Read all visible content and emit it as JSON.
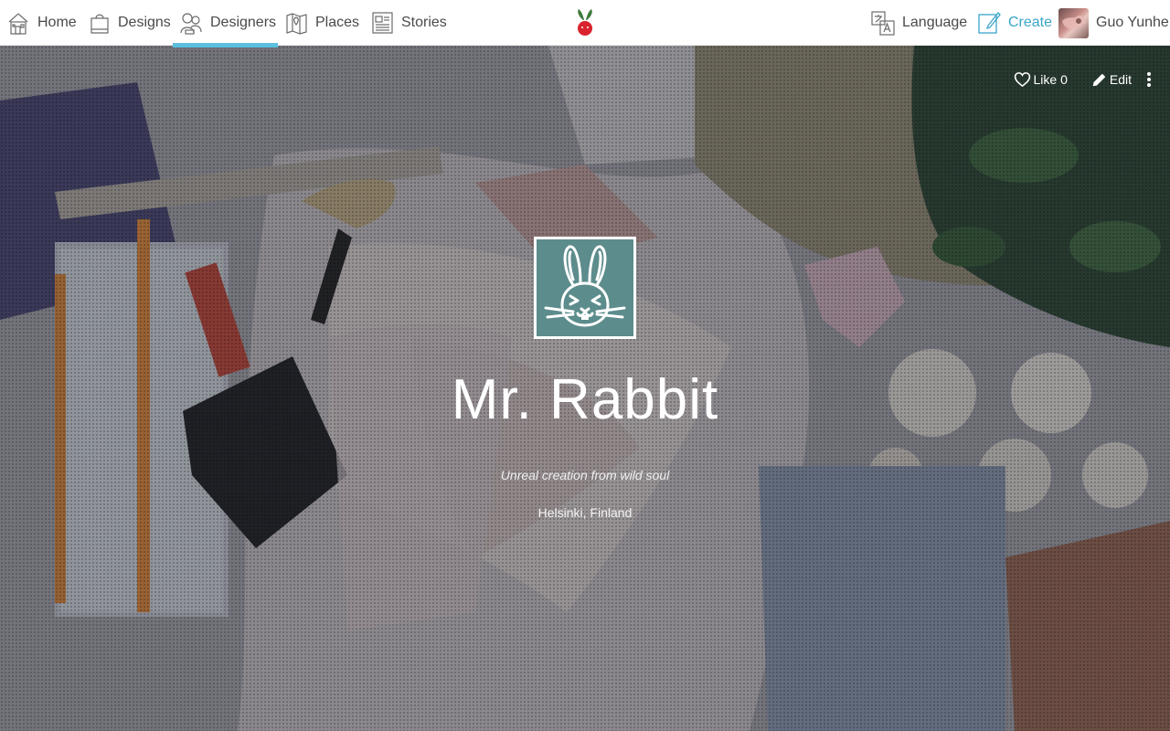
{
  "nav": {
    "home": "Home",
    "designs": "Designs",
    "designers": "Designers",
    "places": "Places",
    "stories": "Stories",
    "language": "Language",
    "create": "Create",
    "user_name": "Guo Yunhe",
    "active_tab": "Designers",
    "icons": [
      "home-icon",
      "designs-icon",
      "designers-icon",
      "places-icon",
      "stories-icon",
      "language-icon",
      "create-icon"
    ]
  },
  "colors": {
    "accent": "#5bc0de",
    "create": "#3aa6c9",
    "avatar_bg": "#5c8c8b",
    "logo_red": "#d9232e",
    "logo_green": "#3e7a3a"
  },
  "profile": {
    "actions": {
      "like_label": "Like 0",
      "edit_label": "Edit"
    },
    "name": "Mr. Rabbit",
    "tagline": "Unreal creation from wild soul",
    "location": "Helsinki, Finland"
  }
}
